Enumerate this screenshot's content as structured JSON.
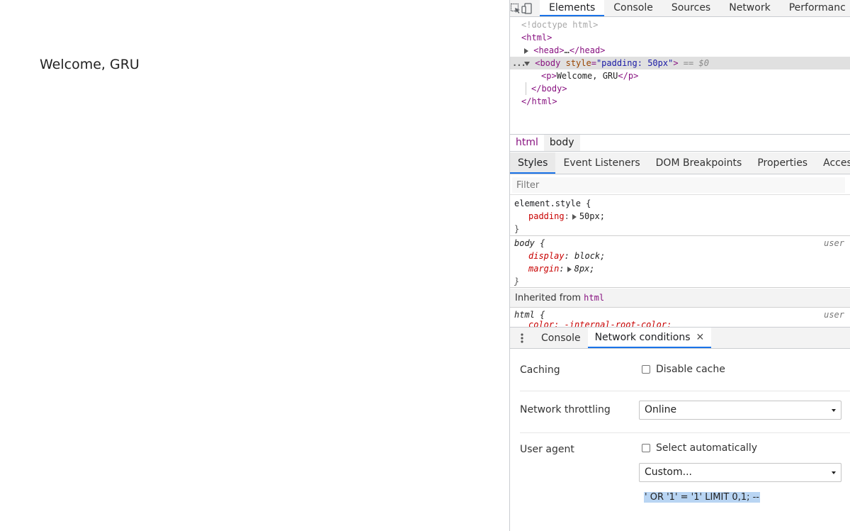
{
  "page": {
    "text": "Welcome, GRU"
  },
  "devtools": {
    "main_tabs": [
      "Elements",
      "Console",
      "Sources",
      "Network",
      "Performanc"
    ],
    "dom": {
      "doctype": "<!doctype html>",
      "html_open": "<html>",
      "head_open": "<head>",
      "head_ellipsis": "…",
      "head_close": "</head>",
      "body_open": "<body",
      "body_attr_name": "style",
      "body_attr_value": "\"padding: 50px\"",
      "body_open_end": ">",
      "selected_marker": "== $0",
      "p_open": "<p>",
      "p_text": "Welcome, GRU",
      "p_close": "</p>",
      "body_close": "</body>",
      "html_close": "</html>",
      "row_ellipsis": "..."
    },
    "breadcrumb": [
      "html",
      "body"
    ],
    "styles_tabs": [
      "Styles",
      "Event Listeners",
      "DOM Breakpoints",
      "Properties",
      "Accessibilit"
    ],
    "filter_placeholder": "Filter",
    "rules": {
      "element_style": {
        "selector": "element.style {",
        "prop": "padding",
        "value": "50px;",
        "close": "}"
      },
      "body_rule": {
        "selector": "body {",
        "origin": "user",
        "props": [
          {
            "name": "display",
            "value": "block;"
          },
          {
            "name": "margin",
            "value": "8px;"
          }
        ],
        "close": "}"
      },
      "inherited_label": "Inherited from",
      "inherited_tag": "html",
      "html_rule": {
        "selector": "html {",
        "origin": "user",
        "partial_prop": "color: -internal-root-color;"
      }
    },
    "drawer_tabs": [
      "Console",
      "Network conditions"
    ],
    "network_conditions": {
      "caching_label": "Caching",
      "disable_cache_label": "Disable cache",
      "throttling_label": "Network throttling",
      "throttling_value": "Online",
      "user_agent_label": "User agent",
      "select_auto_label": "Select automatically",
      "ua_select_value": "Custom...",
      "ua_string": "' OR '1' = '1' LIMIT 0,1; --"
    }
  }
}
